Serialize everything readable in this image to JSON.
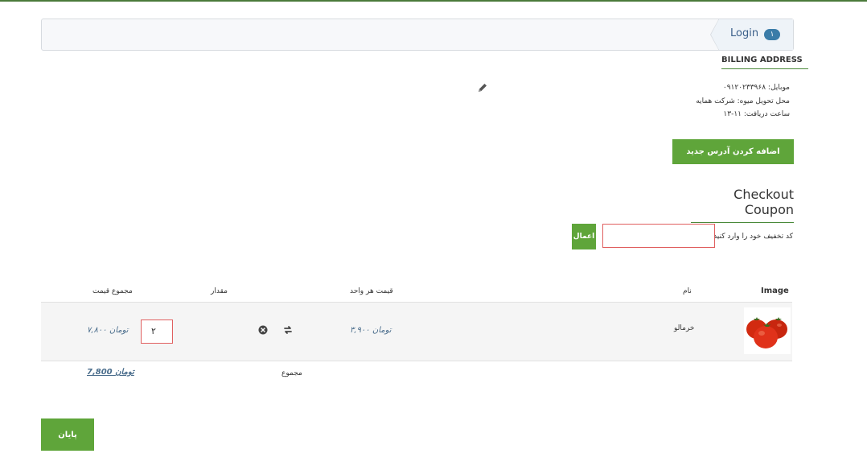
{
  "steps": [
    {
      "label": "Login",
      "badge": "۱"
    }
  ],
  "billing": {
    "title": "BILLING ADDRESS",
    "lines": [
      "موبایل: ۰۹۱۲۰۲۳۳۹۶۸",
      "محل تحویل میوه: شرکت همایه",
      "ساعت دریافت: ۱۱-۱۳"
    ],
    "edit_icon": "pencil-icon",
    "add_button": "اضافه کردن آدرس جدید"
  },
  "coupon": {
    "title": "Checkout Coupon",
    "label": "کد تخفیف خود را وارد کنید:",
    "value": "",
    "apply_button": "اعمال"
  },
  "cart": {
    "headers": {
      "image": "Image",
      "name": "نام",
      "unit_price": "قیمت هر واحد",
      "quantity": "مقدار",
      "total": "مجموع قیمت"
    },
    "rows": [
      {
        "image_icon": "tomato-image",
        "name": "خرمالو",
        "unit_price": "۳,۹۰۰ تومان",
        "quantity": "۲",
        "total": "۷,۸۰۰ تومان",
        "update_icon": "refresh-icon",
        "remove_icon": "remove-circle-icon"
      }
    ],
    "total_label": "مجموع",
    "total_value": "7,800 تومان"
  },
  "finish_button": "پایان",
  "colors": {
    "accent": "#5fa53a",
    "price": "#4a6d8c",
    "error_border": "#e06060"
  }
}
